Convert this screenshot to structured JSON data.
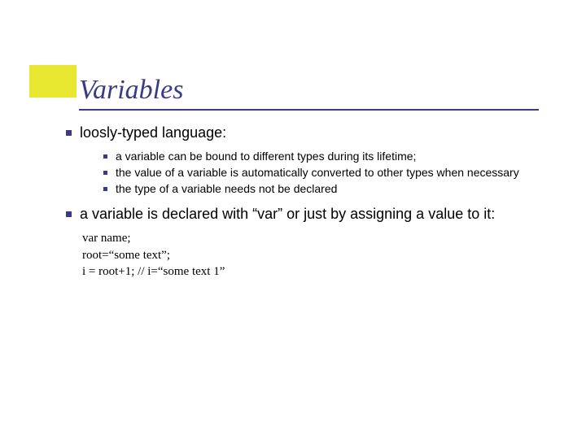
{
  "title": "Variables",
  "points": {
    "p1": "loosly-typed language:",
    "sub1": "a variable can be bound to different types during its lifetime;",
    "sub2": "the value of a variable is automatically converted to other types when necessary",
    "sub3": "the type of a variable needs not be declared",
    "p2": "a variable is declared with “var” or just by assigning a value to it:"
  },
  "code": {
    "line1": "var name;",
    "line2": "root=“some text”;",
    "line3": "i = root+1; // i=“some text 1”"
  }
}
